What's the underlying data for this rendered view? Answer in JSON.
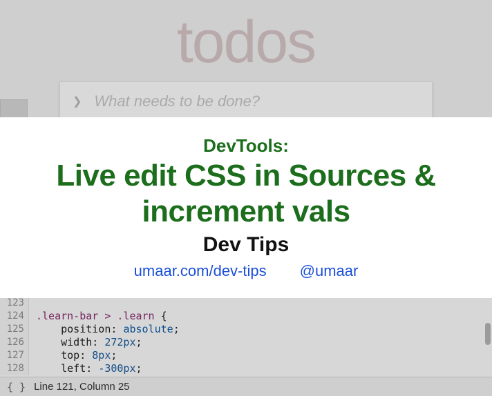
{
  "todos": {
    "logo": "todos",
    "placeholder": "What needs to be done?"
  },
  "code": {
    "lines": [
      {
        "num": "123",
        "text": ""
      },
      {
        "num": "124",
        "selector": ".learn-bar > .learn",
        "brace": " {"
      },
      {
        "num": "125",
        "indent": "    ",
        "prop": "position",
        "val": "absolute"
      },
      {
        "num": "126",
        "indent": "    ",
        "prop": "width",
        "val": "272px"
      },
      {
        "num": "127",
        "indent": "    ",
        "prop": "top",
        "val": "8px"
      },
      {
        "num": "128",
        "indent": "    ",
        "prop": "left",
        "val": "-300px"
      }
    ]
  },
  "status": {
    "text": "Line 121, Column 25"
  },
  "overlay": {
    "kicker": "DevTools:",
    "title": "Live edit CSS in Sources & increment vals",
    "subtitle": "Dev Tips",
    "link1": "umaar.com/dev-tips",
    "link2": "@umaar"
  }
}
